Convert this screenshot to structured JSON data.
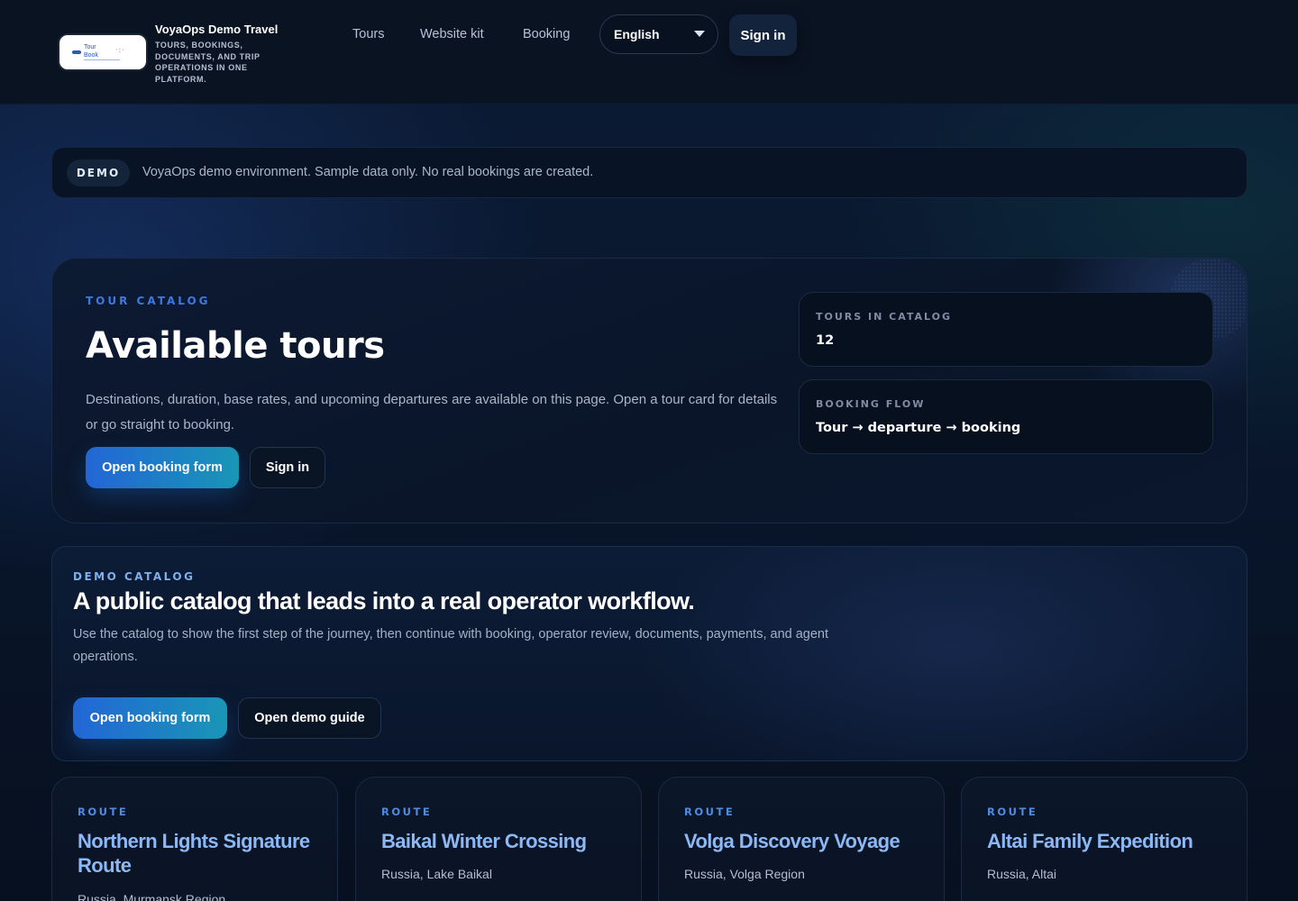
{
  "header": {
    "logo_text": [
      "Tour",
      "Book"
    ],
    "brand_name": "VoyaOps Demo Travel",
    "brand_tagline": "TOURS, BOOKINGS, DOCUMENTS, AND TRIP OPERATIONS IN ONE PLATFORM.",
    "nav": [
      {
        "label": "Tours"
      },
      {
        "label": "Website kit"
      },
      {
        "label": "Booking"
      }
    ],
    "language": {
      "selected": "English",
      "icon": "chevron-down-icon"
    },
    "sign_in_label": "Sign in"
  },
  "notice": {
    "badge": "DEMO",
    "message": "VoyaOps demo environment. Sample data only. No real bookings are created."
  },
  "hero": {
    "kicker": "TOUR CATALOG",
    "title": "Available tours",
    "description": "Destinations, duration, base rates, and upcoming departures are available on this page. Open a tour card for details or go straight to booking.",
    "primary_button": "Open booking form",
    "secondary_button": "Sign in",
    "stats": [
      {
        "label": "TOURS IN CATALOG",
        "value": "12"
      },
      {
        "label": "BOOKING FLOW",
        "value": "Tour → departure → booking"
      }
    ]
  },
  "demo_catalog": {
    "kicker": "DEMO CATALOG",
    "title": "A public catalog that leads into a real operator workflow.",
    "description": "Use the catalog to show the first step of the journey, then continue with booking, operator review, documents, payments, and agent operations.",
    "primary_button": "Open booking form",
    "secondary_button": "Open demo guide"
  },
  "tours": [
    {
      "route_label": "ROUTE",
      "name": "Northern Lights Signature Route",
      "location": "Russia, Murmansk Region"
    },
    {
      "route_label": "ROUTE",
      "name": "Baikal Winter Crossing",
      "location": "Russia, Lake Baikal"
    },
    {
      "route_label": "ROUTE",
      "name": "Volga Discovery Voyage",
      "location": "Russia, Volga Region"
    },
    {
      "route_label": "ROUTE",
      "name": "Altai Family Expedition",
      "location": "Russia, Altai"
    }
  ],
  "colors": {
    "background": "#07101f",
    "accent_blue": "#2266d6",
    "accent_teal": "#1996b6",
    "kicker_blue": "#3d79e0",
    "tour_title": "#8cb8f5"
  }
}
